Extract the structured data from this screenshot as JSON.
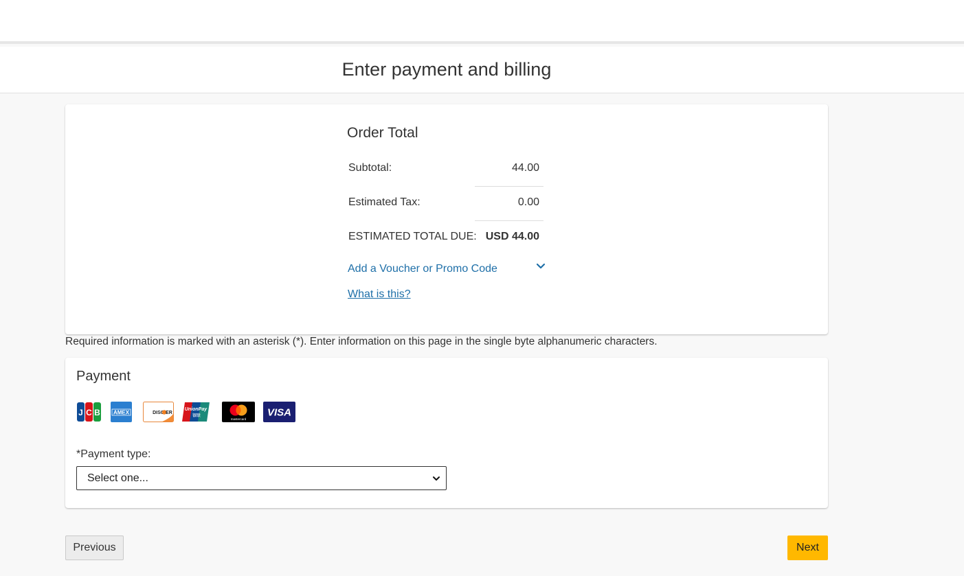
{
  "page": {
    "title": "Enter payment and billing"
  },
  "order": {
    "heading": "Order Total",
    "subtotal_label": "Subtotal:",
    "subtotal_value": "44.00",
    "tax_label": "Estimated Tax:",
    "tax_value": "0.00",
    "total_label": "ESTIMATED TOTAL DUE:",
    "total_value": "USD 44.00",
    "voucher_label": "Add a Voucher or Promo Code",
    "what_is_this": "What is this?"
  },
  "required_note": "Required information is marked with an asterisk (*). Enter information on this page in the single byte alphanumeric characters.",
  "payment": {
    "heading": "Payment",
    "card_logos": [
      "jcb-icon",
      "amex-icon",
      "discover-icon",
      "unionpay-icon",
      "mastercard-icon",
      "visa-icon"
    ],
    "type_label": "*Payment type:",
    "type_selected": "Select one..."
  },
  "nav": {
    "previous": "Previous",
    "next": "Next"
  },
  "colors": {
    "link": "#1e6fa8",
    "next_button": "#ffb800",
    "background": "#f8f8f8"
  }
}
